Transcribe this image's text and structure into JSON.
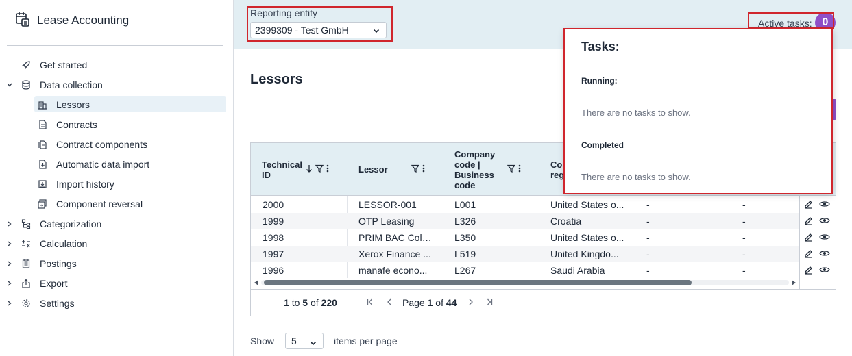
{
  "app": {
    "title": "Lease Accounting"
  },
  "sidebar": {
    "items": [
      {
        "label": "Get started",
        "icon": "rocket-icon"
      },
      {
        "label": "Data collection",
        "icon": "database-icon",
        "expanded": true
      },
      {
        "label": "Lessors",
        "icon": "building-icon",
        "active": true
      },
      {
        "label": "Contracts",
        "icon": "document-icon"
      },
      {
        "label": "Contract components",
        "icon": "documents-icon"
      },
      {
        "label": "Automatic data import",
        "icon": "file-import-icon"
      },
      {
        "label": "Import history",
        "icon": "history-icon"
      },
      {
        "label": "Component reversal",
        "icon": "reverse-icon"
      },
      {
        "label": "Categorization",
        "icon": "hierarchy-icon"
      },
      {
        "label": "Calculation",
        "icon": "calculator-icon"
      },
      {
        "label": "Postings",
        "icon": "clipboard-icon"
      },
      {
        "label": "Export",
        "icon": "export-icon"
      },
      {
        "label": "Settings",
        "icon": "gear-icon"
      }
    ]
  },
  "header": {
    "entity_label": "Reporting entity",
    "entity_value": "2399309 - Test GmbH",
    "active_tasks_label": "Active tasks:",
    "active_tasks_count": "0"
  },
  "page": {
    "title": "Lessors"
  },
  "table": {
    "columns": [
      {
        "label": "Technical ID"
      },
      {
        "label": "Lessor"
      },
      {
        "label": "Company code | Business code"
      },
      {
        "label": "Cou... reg..."
      }
    ],
    "rows": [
      {
        "id": "2000",
        "lessor": "LESSOR-001",
        "code": "L001",
        "country": "United States o...",
        "c5": "-",
        "c6": "-"
      },
      {
        "id": "1999",
        "lessor": "OTP Leasing",
        "code": "L326",
        "country": "Croatia",
        "c5": "-",
        "c6": "-"
      },
      {
        "id": "1998",
        "lessor": "PRIM BAC Colo...",
        "code": "L350",
        "country": "United States o...",
        "c5": "-",
        "c6": "-"
      },
      {
        "id": "1997",
        "lessor": "Xerox Finance ...",
        "code": "L519",
        "country": "United Kingdo...",
        "c5": "-",
        "c6": "-"
      },
      {
        "id": "1996",
        "lessor": "manafe econo...",
        "code": "L267",
        "country": "Saudi Arabia",
        "c5": "-",
        "c6": "-"
      }
    ]
  },
  "pager": {
    "range_from": "1",
    "to_word": "to",
    "range_to": "5",
    "of_word": "of",
    "total": "220",
    "page_word": "Page",
    "page": "1",
    "page_of_word": "of",
    "pages": "44"
  },
  "page_size": {
    "show_label": "Show",
    "value": "5",
    "suffix": "items per page"
  },
  "tasks_popup": {
    "title": "Tasks:",
    "running_label": "Running:",
    "running_empty": "There are no tasks to show.",
    "completed_label": "Completed",
    "completed_empty": "There are no tasks to show."
  },
  "colors": {
    "accent": "#8f4fc8",
    "header_band": "#e2eef3",
    "highlight_box": "#d0262d"
  }
}
